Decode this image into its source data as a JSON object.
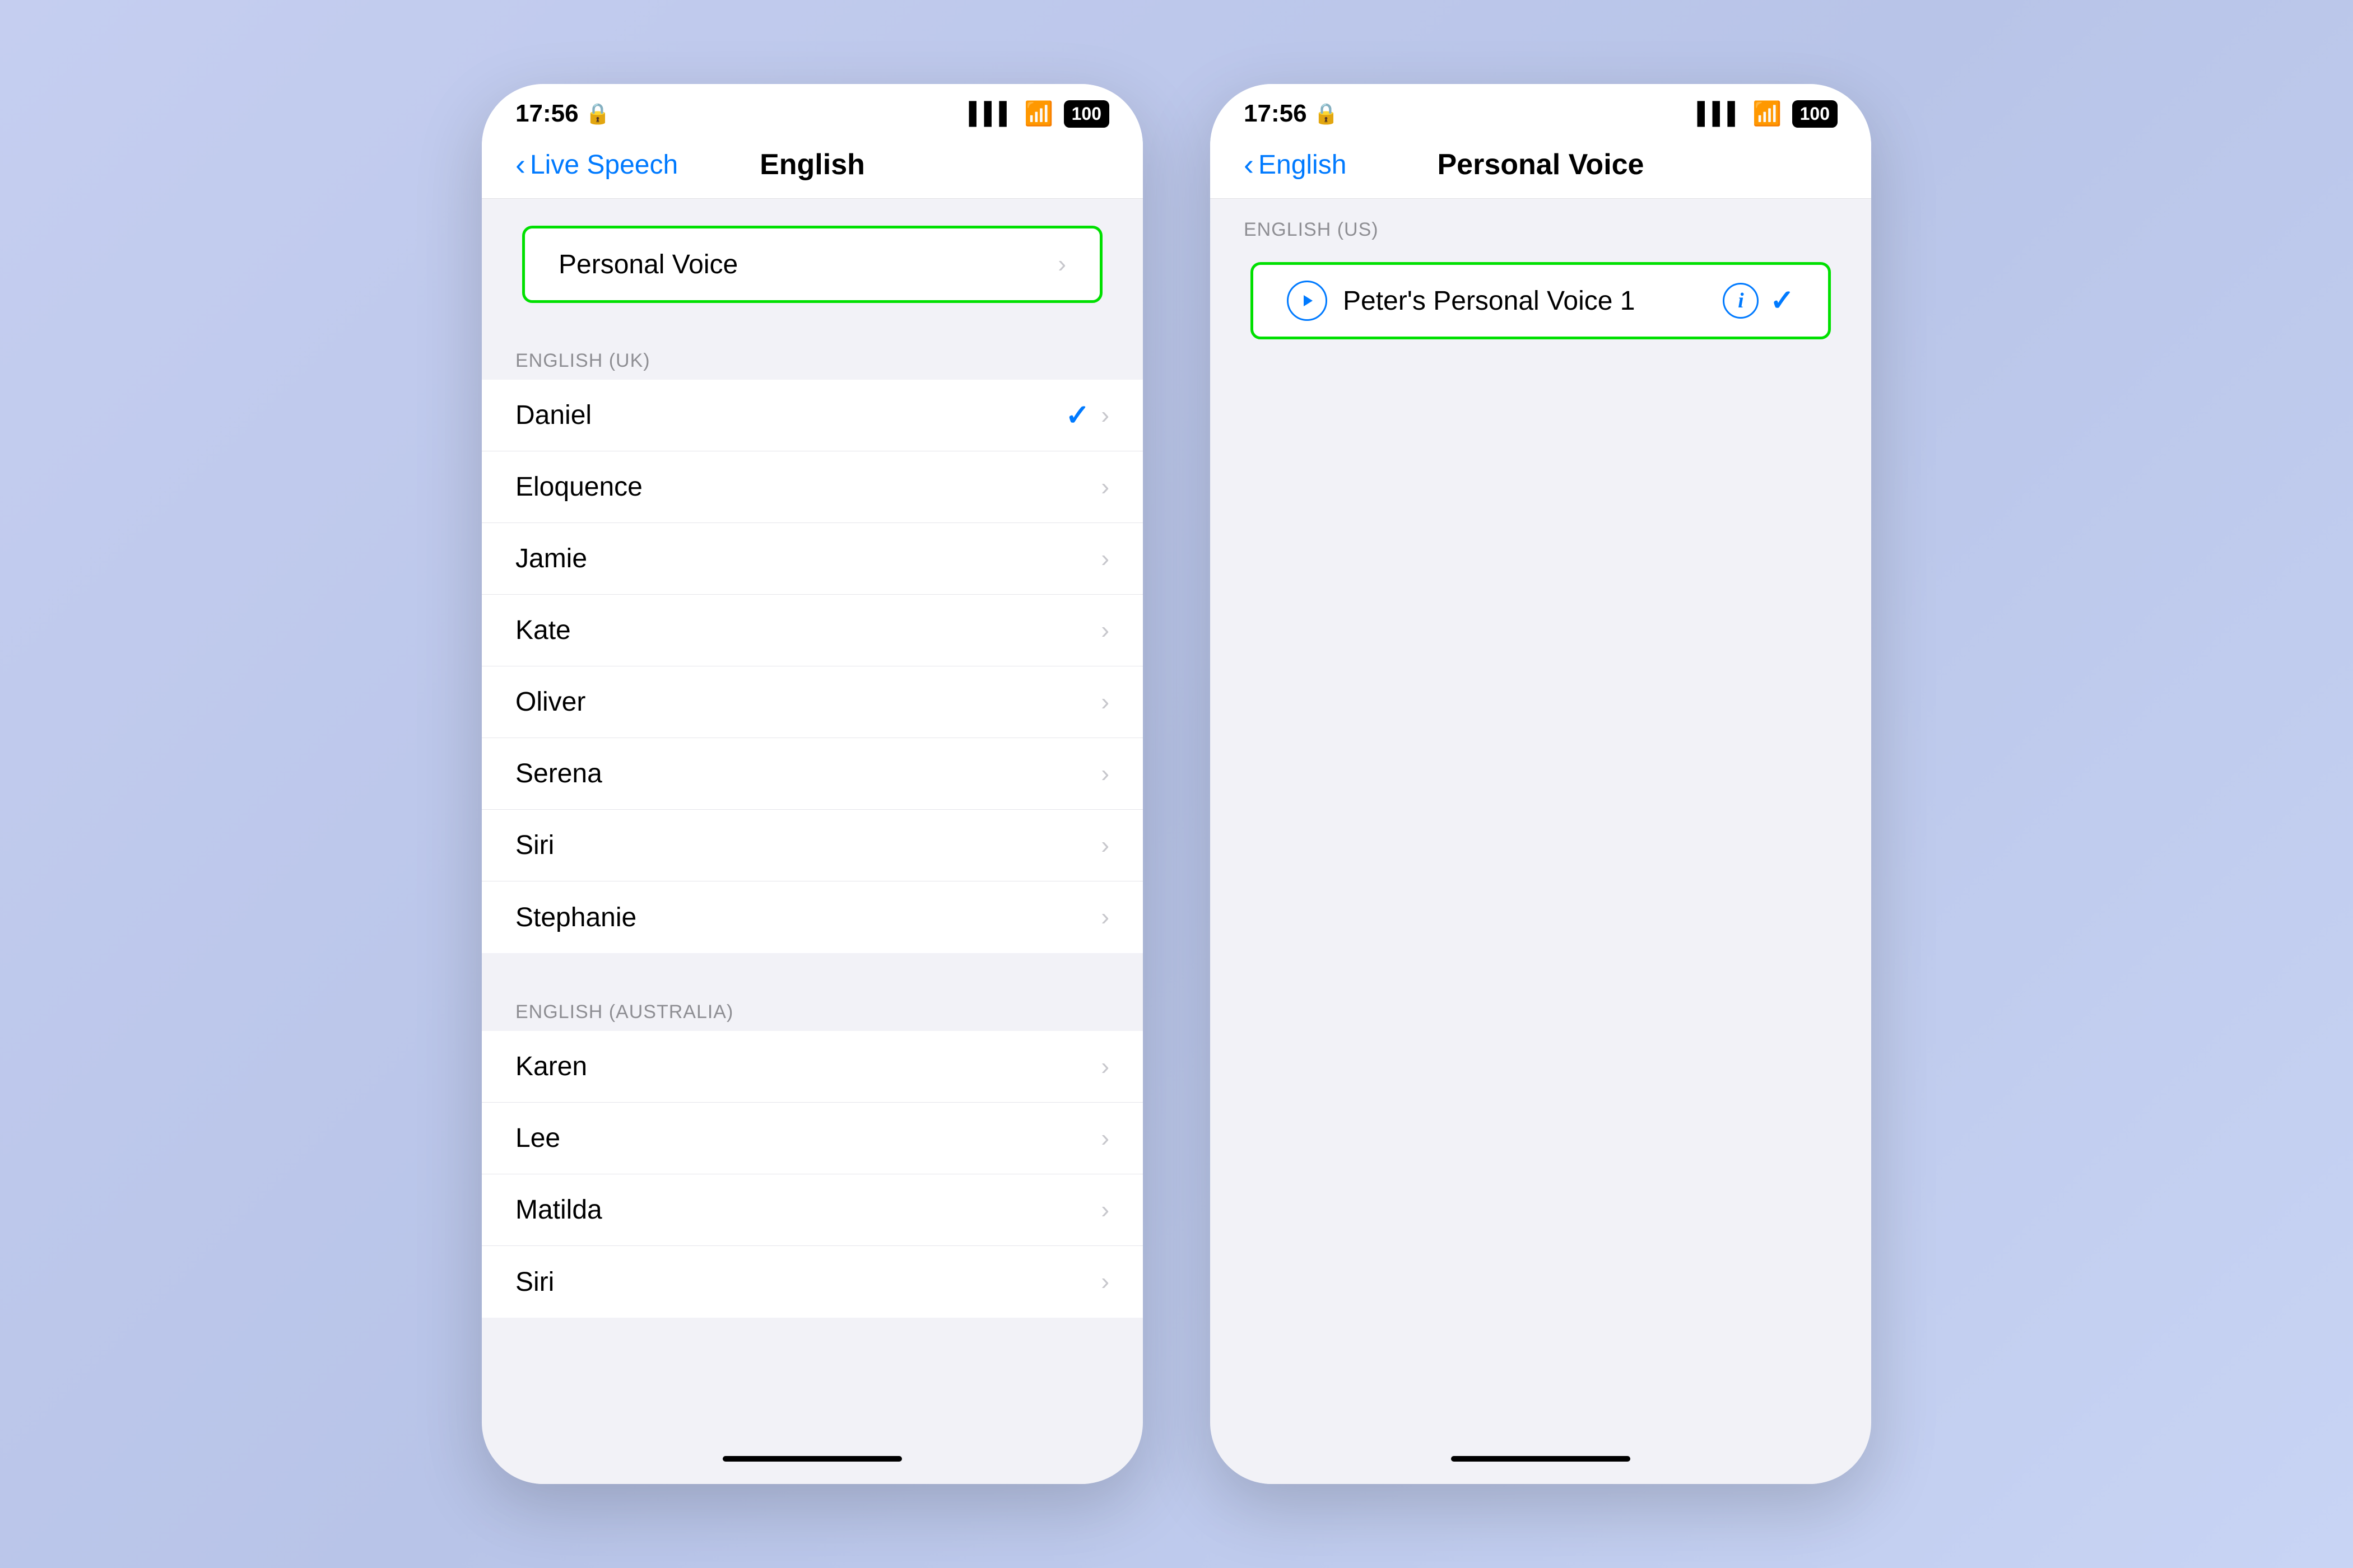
{
  "background_color": "#c5cef0",
  "phone1": {
    "status_bar": {
      "time": "17:56",
      "signal_icon": "▌▌▌",
      "wifi_icon": "wifi",
      "battery": "100"
    },
    "nav": {
      "back_label": "Live Speech",
      "title": "English"
    },
    "highlighted_section": {
      "item_label": "Personal Voice"
    },
    "section_uk": {
      "label": "ENGLISH (UK)",
      "items": [
        {
          "name": "Daniel",
          "checked": true
        },
        {
          "name": "Eloquence",
          "checked": false
        },
        {
          "name": "Jamie",
          "checked": false
        },
        {
          "name": "Kate",
          "checked": false
        },
        {
          "name": "Oliver",
          "checked": false
        },
        {
          "name": "Serena",
          "checked": false
        },
        {
          "name": "Siri",
          "checked": false
        },
        {
          "name": "Stephanie",
          "checked": false
        }
      ]
    },
    "section_australia": {
      "label": "ENGLISH (AUSTRALIA)",
      "items": [
        {
          "name": "Karen",
          "checked": false
        },
        {
          "name": "Lee",
          "checked": false
        },
        {
          "name": "Matilda",
          "checked": false
        },
        {
          "name": "Siri",
          "checked": false
        }
      ]
    }
  },
  "phone2": {
    "status_bar": {
      "time": "17:56",
      "signal_icon": "▌▌▌",
      "wifi_icon": "wifi",
      "battery": "100"
    },
    "nav": {
      "back_label": "English",
      "title": "Personal Voice"
    },
    "section_us": {
      "label": "ENGLISH (US)",
      "highlighted_item": {
        "voice_name": "Peter's Personal Voice 1",
        "checked": true
      }
    }
  },
  "icons": {
    "chevron": "›",
    "checkmark": "✓",
    "back_arrow": "‹",
    "play": "▶",
    "info": "i"
  }
}
